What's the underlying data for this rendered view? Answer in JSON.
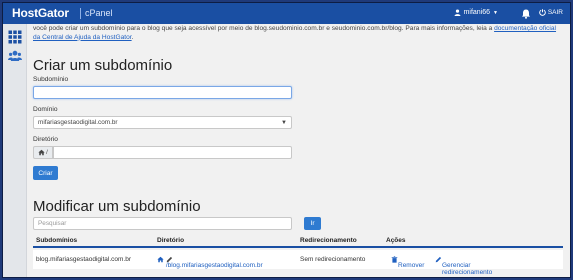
{
  "header": {
    "brand": "HostGator",
    "product": "cPanel",
    "username": "mifani66",
    "logout_label": "SAIR"
  },
  "sidebar": {
    "items": [
      {
        "icon": "grid-icon"
      },
      {
        "icon": "users-icon"
      }
    ]
  },
  "intro": {
    "text": "você pode criar um subdomínio para o blog que seja acessível por meio de blog.seudominio.com.br e seudominio.com.br/blog. Para mais informações, leia a ",
    "link_text": "documentação oficial da Central de Ajuda da HostGator",
    "trailing": "."
  },
  "create": {
    "title": "Criar um subdomínio",
    "subdomain_label": "Subdomínio",
    "subdomain_value": "",
    "domain_label": "Domínio",
    "domain_selected": "mifariasgestaodigital.com.br",
    "directory_label": "Diretório",
    "directory_prefix": "/",
    "directory_value": "",
    "submit_label": "Criar"
  },
  "modify": {
    "title": "Modificar um subdomínio",
    "search_placeholder": "Pesquisar",
    "search_button": "Ir",
    "columns": [
      "Subdomínios",
      "Diretório",
      "Redirecionamento",
      "Ações"
    ],
    "rows": [
      {
        "subdomain": "blog.mifariasgestaodigital.com.br",
        "directory": "/blog.mifariasgestaodigital.com.br",
        "redirect": "Sem redirecionamento",
        "remove_label": "Remover",
        "manage_label": "Gerenciar redirecionamento"
      }
    ]
  },
  "colors": {
    "topbar": "#1a4fa3",
    "primary_button": "#2f7bd1",
    "link": "#2060c0"
  }
}
